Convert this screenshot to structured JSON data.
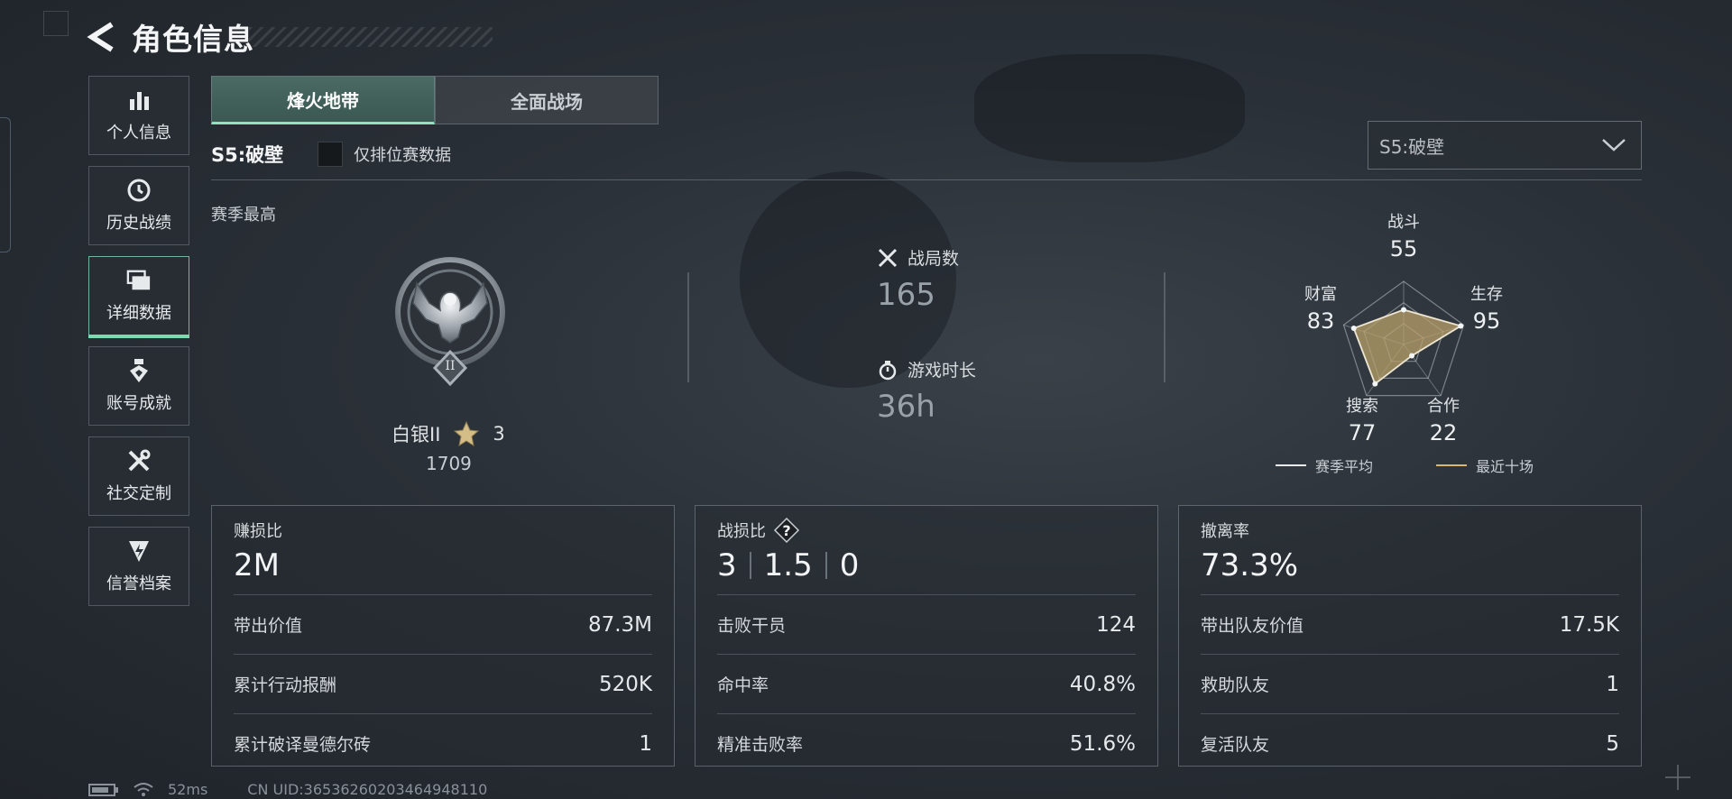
{
  "header": {
    "title": "角色信息"
  },
  "sidebar": {
    "items": [
      {
        "label": "个人信息",
        "icon": "bar-chart-icon"
      },
      {
        "label": "历史战绩",
        "icon": "history-clock-icon"
      },
      {
        "label": "详细数据",
        "icon": "folder-stack-icon",
        "active": true
      },
      {
        "label": "账号成就",
        "icon": "medal-icon"
      },
      {
        "label": "社交定制",
        "icon": "tools-icon"
      },
      {
        "label": "信誉档案",
        "icon": "shield-bolt-icon"
      }
    ]
  },
  "tabs": [
    {
      "label": "烽火地带",
      "active": true
    },
    {
      "label": "全面战场",
      "active": false
    }
  ],
  "filter": {
    "season_label": "S5:破壁",
    "ranked_only_label": "仅排位赛数据",
    "ranked_only_checked": false,
    "season_dropdown_value": "S5:破壁"
  },
  "season_best": {
    "section_label": "赛季最高",
    "rank_name": "白银II",
    "rank_numeral": "II",
    "stars": "3",
    "score": "1709"
  },
  "overview": {
    "matches_label": "战局数",
    "matches_value": "165",
    "playtime_label": "游戏时长",
    "playtime_value": "36h"
  },
  "radar": {
    "axes": [
      {
        "label": "战斗",
        "value": "55"
      },
      {
        "label": "生存",
        "value": "95"
      },
      {
        "label": "合作",
        "value": "22"
      },
      {
        "label": "搜索",
        "value": "77"
      },
      {
        "label": "财富",
        "value": "83"
      }
    ],
    "legend": {
      "season_avg": "赛季平均",
      "recent10": "最近十场"
    },
    "colors": {
      "season_avg": "#e8ecef",
      "recent10": "#d8b870",
      "fill": "#b8a06a"
    }
  },
  "cards": {
    "profit": {
      "title": "赚损比",
      "main": "2M",
      "rows": [
        {
          "label": "带出价值",
          "value": "87.3M"
        },
        {
          "label": "累计行动报酬",
          "value": "520K"
        },
        {
          "label": "累计破译曼德尔砖",
          "value": "1"
        }
      ]
    },
    "combat": {
      "title": "战损比",
      "kd": [
        "3",
        "1.5",
        "0"
      ],
      "rows": [
        {
          "label": "击败干员",
          "value": "124"
        },
        {
          "label": "命中率",
          "value": "40.8%"
        },
        {
          "label": "精准击败率",
          "value": "51.6%"
        }
      ]
    },
    "extract": {
      "title": "撤离率",
      "main": "73.3%",
      "rows": [
        {
          "label": "带出队友价值",
          "value": "17.5K"
        },
        {
          "label": "救助队友",
          "value": "1"
        },
        {
          "label": "复活队友",
          "value": "5"
        }
      ]
    }
  },
  "footer": {
    "ping": "52ms",
    "uid": "CN UID:36536260203464948110"
  }
}
